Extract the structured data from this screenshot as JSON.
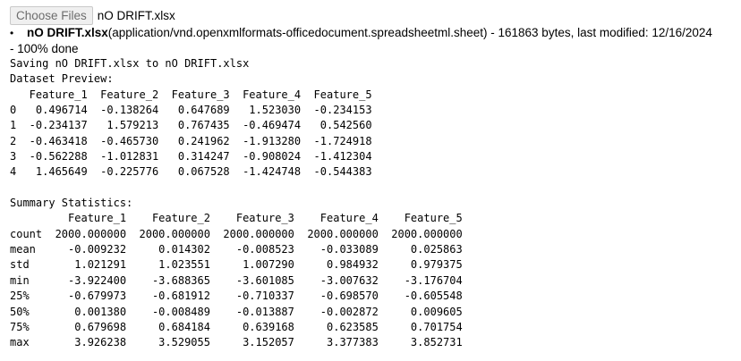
{
  "upload": {
    "button_label": "Choose Files",
    "chosen_file": "nO DRIFT.xlsx"
  },
  "file_info": {
    "bullet": "•",
    "name": "nO DRIFT.xlsx",
    "type": "(application/vnd.openxmlformats-officedocument.spreadsheetml.sheet)",
    "meta": " - 161863 bytes, last modified: 12/16/2024",
    "progress": "- 100% done"
  },
  "output": {
    "saving": "Saving nO DRIFT.xlsx to nO DRIFT.xlsx",
    "preview_title": "Dataset Preview:",
    "preview_lines": [
      "   Feature_1  Feature_2  Feature_3  Feature_4  Feature_5",
      "0   0.496714  -0.138264   0.647689   1.523030  -0.234153",
      "1  -0.234137   1.579213   0.767435  -0.469474   0.542560",
      "2  -0.463418  -0.465730   0.241962  -1.913280  -1.724918",
      "3  -0.562288  -1.012831   0.314247  -0.908024  -1.412304",
      "4   1.465649  -0.225776   0.067528  -1.424748  -0.544383"
    ],
    "blank": "",
    "summary_title": "Summary Statistics:",
    "summary_lines": [
      "         Feature_1    Feature_2    Feature_3    Feature_4    Feature_5",
      "count  2000.000000  2000.000000  2000.000000  2000.000000  2000.000000",
      "mean     -0.009232     0.014302    -0.008523    -0.033089     0.025863",
      "std       1.021291     1.023551     1.007290     0.984932     0.979375",
      "min      -3.922400    -3.688365    -3.601085    -3.007632    -3.176704",
      "25%      -0.679973    -0.681912    -0.710337    -0.698570    -0.605548",
      "50%       0.001380    -0.008489    -0.013887    -0.002872     0.009605",
      "75%       0.679698     0.684184     0.639168     0.623585     0.701754",
      "max       3.926238     3.529055     3.152057     3.377383     3.852731"
    ]
  }
}
